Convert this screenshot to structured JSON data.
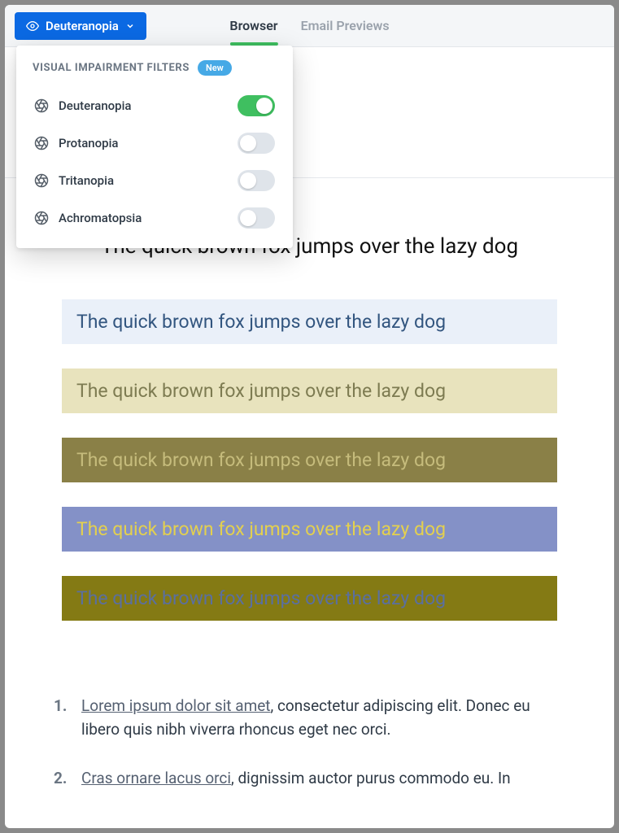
{
  "toolbar": {
    "active_filter": "Deuteranopia"
  },
  "tabs": {
    "browser": "Browser",
    "email_previews": "Email Previews"
  },
  "dropdown": {
    "title": "VISUAL IMPAIRMENT FILTERS",
    "badge": "New",
    "filters": [
      {
        "name": "Deuteranopia",
        "on": true
      },
      {
        "name": "Protanopia",
        "on": false
      },
      {
        "name": "Tritanopia",
        "on": false
      },
      {
        "name": "Achromatopsia",
        "on": false
      }
    ]
  },
  "content": {
    "sample_text": "The quick brown fox jumps over the lazy dog",
    "swatches": [
      {
        "text": "The quick brown fox jumps over the lazy dog"
      },
      {
        "text": "The quick brown fox jumps over the lazy dog"
      },
      {
        "text": "The quick brown fox jumps over the lazy dog"
      },
      {
        "text": "The quick brown fox jumps over the lazy dog"
      },
      {
        "text": "The quick brown fox jumps over the lazy dog"
      }
    ],
    "list": [
      {
        "link": "Lorem ipsum dolor sit amet",
        "rest": ", consectetur adipiscing elit. Donec eu libero quis nibh viverra rhoncus eget nec orci."
      },
      {
        "link": "Cras ornare lacus orci",
        "rest": ", dignissim auctor purus commodo eu. In"
      }
    ]
  }
}
